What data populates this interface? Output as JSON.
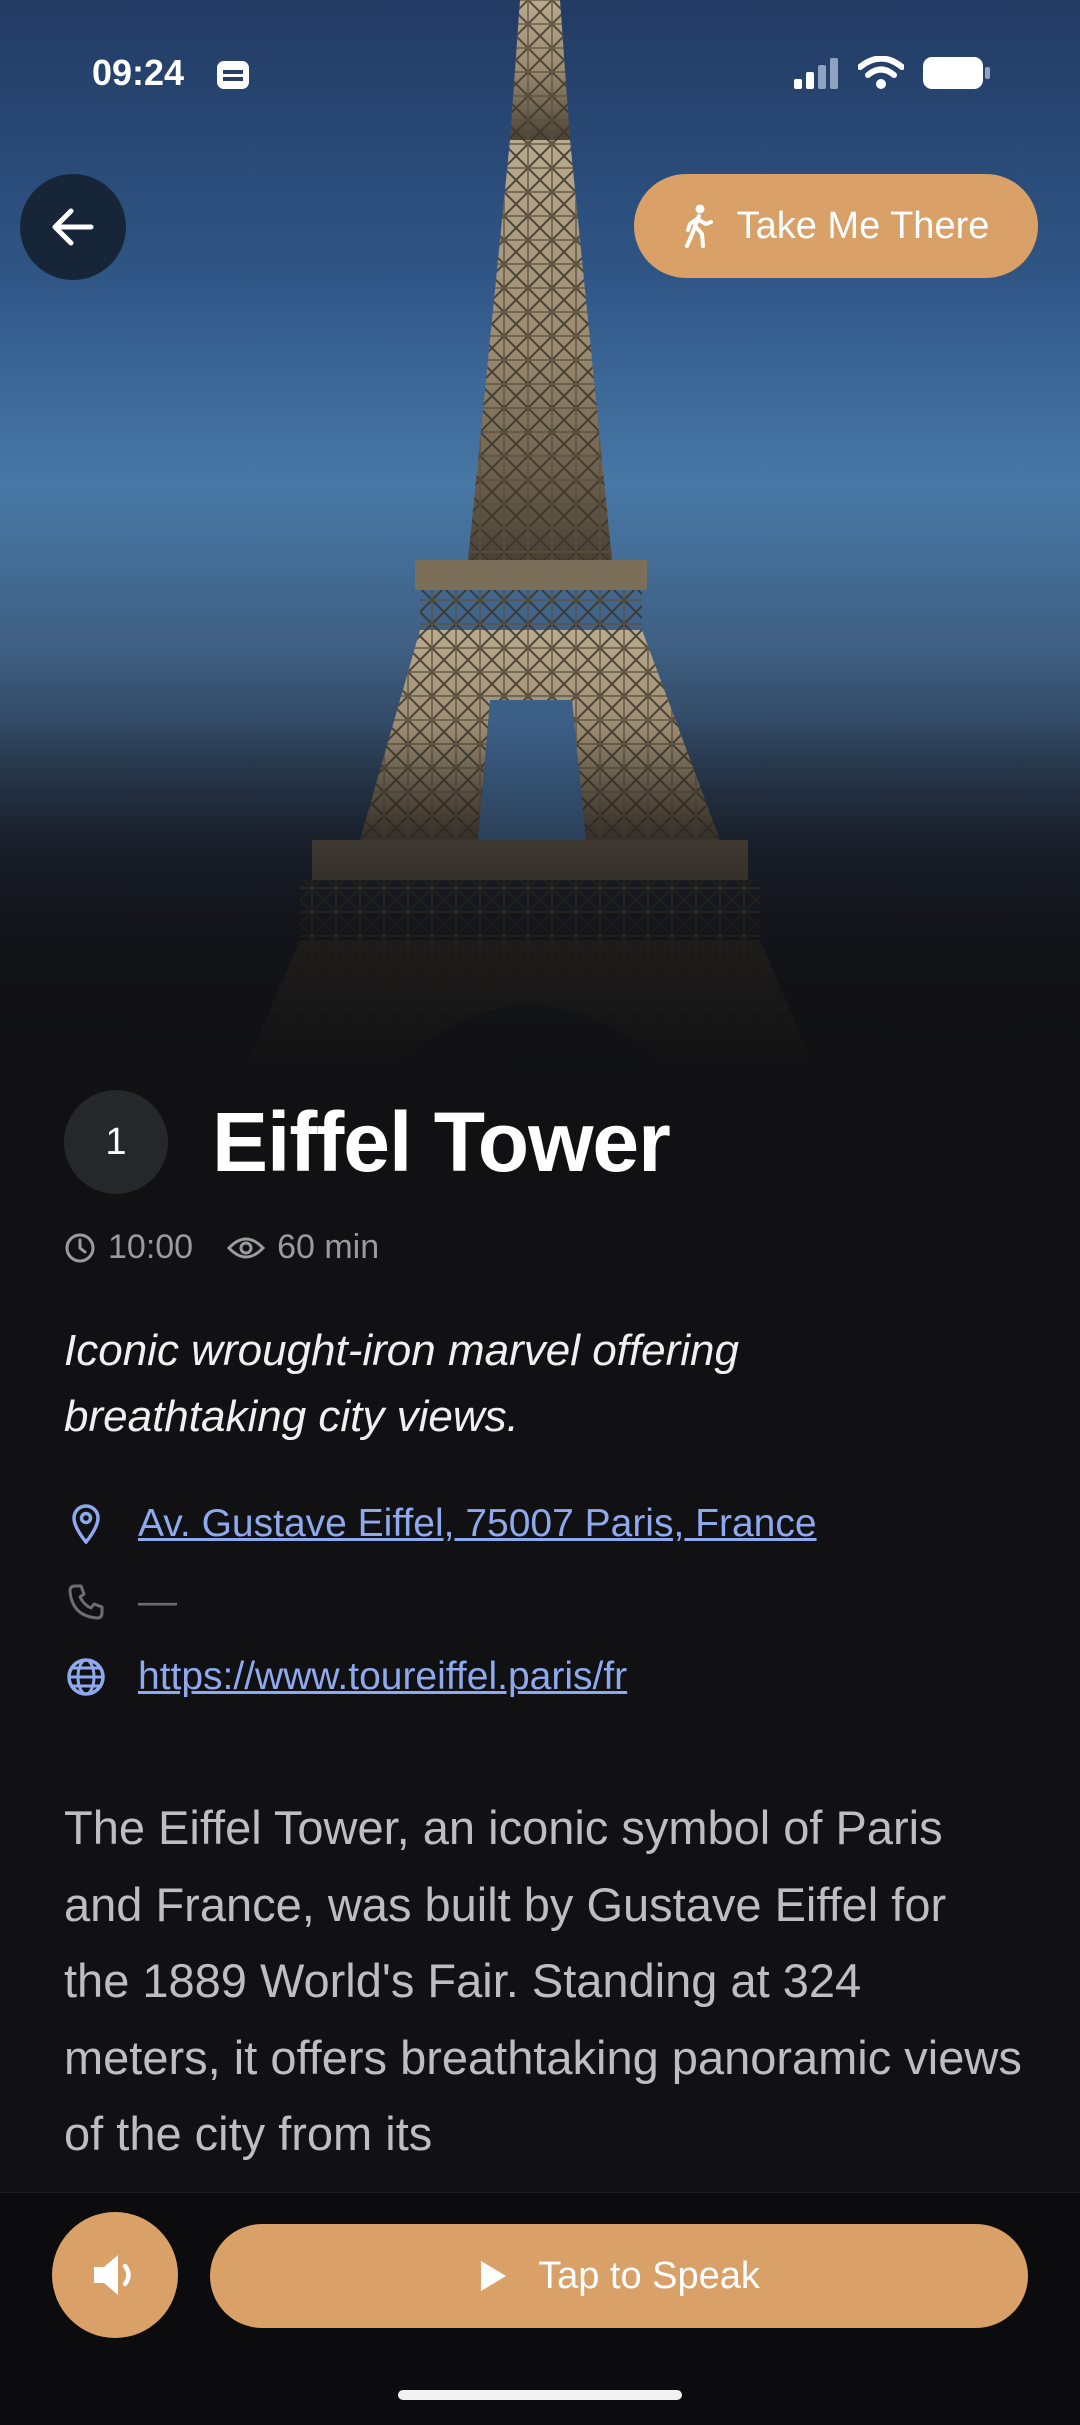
{
  "status_bar": {
    "time": "09:24"
  },
  "header": {
    "back_icon": "arrow-left-icon",
    "take_me_there_label": "Take Me There",
    "take_me_there_icon": "walking-person-icon"
  },
  "place": {
    "number": "1",
    "title": "Eiffel Tower",
    "time": "10:00",
    "duration": "60 min",
    "tagline": "Iconic wrought-iron marvel offering breathtaking city views.",
    "address": "Av. Gustave Eiffel, 75007 Paris, France",
    "phone": "—",
    "website": "https://www.toureiffel.paris/fr",
    "description": "The Eiffel Tower, an iconic symbol of Paris and France, was built by Gustave Eiffel for the 1889 World's Fair. Standing at 324 meters, it offers breathtaking panoramic views of the city from its"
  },
  "footer": {
    "speaker_icon": "speaker-icon",
    "speak_label": "Tap to Speak",
    "play_icon": "play-icon"
  },
  "colors": {
    "accent": "#d9a068",
    "link": "#8ea9ee",
    "background": "#111113"
  }
}
